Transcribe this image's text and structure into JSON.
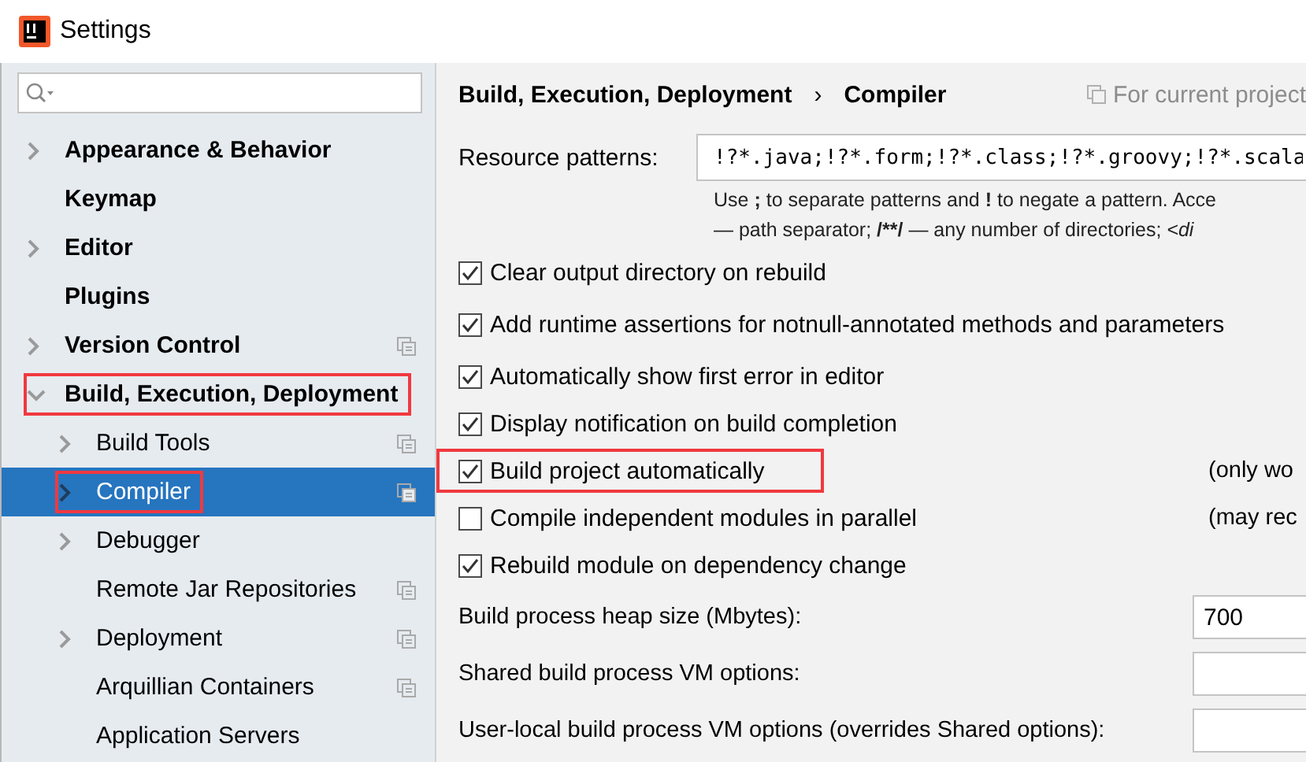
{
  "window": {
    "title": "Settings"
  },
  "tree": [
    {
      "label": "Appearance & Behavior",
      "expandable": true,
      "expanded": false,
      "project_level": false,
      "selected": false,
      "highlighted": false
    },
    {
      "label": "Keymap",
      "expandable": false,
      "project_level": false,
      "selected": false,
      "highlighted": false
    },
    {
      "label": "Editor",
      "expandable": true,
      "expanded": false,
      "project_level": false,
      "selected": false,
      "highlighted": false
    },
    {
      "label": "Plugins",
      "expandable": false,
      "project_level": false,
      "selected": false,
      "highlighted": false
    },
    {
      "label": "Version Control",
      "expandable": true,
      "expanded": false,
      "project_level": true,
      "selected": false,
      "highlighted": false
    },
    {
      "label": "Build, Execution, Deployment",
      "expandable": true,
      "expanded": true,
      "project_level": false,
      "selected": false,
      "highlighted": true,
      "children": [
        {
          "label": "Build Tools",
          "expandable": true,
          "expanded": false,
          "project_level": true,
          "selected": false,
          "highlighted": false
        },
        {
          "label": "Compiler",
          "expandable": true,
          "expanded": false,
          "project_level": true,
          "selected": true,
          "highlighted": true
        },
        {
          "label": "Debugger",
          "expandable": true,
          "expanded": false,
          "project_level": false,
          "selected": false,
          "highlighted": false
        },
        {
          "label": "Remote Jar Repositories",
          "expandable": false,
          "project_level": true,
          "selected": false,
          "highlighted": false
        },
        {
          "label": "Deployment",
          "expandable": true,
          "expanded": false,
          "project_level": true,
          "selected": false,
          "highlighted": false
        },
        {
          "label": "Arquillian Containers",
          "expandable": false,
          "project_level": true,
          "selected": false,
          "highlighted": false
        },
        {
          "label": "Application Servers",
          "expandable": false,
          "project_level": false,
          "selected": false,
          "highlighted": false
        }
      ]
    }
  ],
  "breadcrumb": {
    "parent": "Build, Execution, Deployment",
    "separator": "›",
    "current": "Compiler",
    "scope": "For current project"
  },
  "resource_patterns": {
    "label": "Resource patterns:",
    "value": "!?*.java;!?*.form;!?*.class;!?*.groovy;!?*.scala",
    "hint_lines": [
      [
        {
          "kind": "plain",
          "text": "Use "
        },
        {
          "kind": "bold",
          "text": ";"
        },
        {
          "kind": "plain",
          "text": " to separate patterns and "
        },
        {
          "kind": "bold",
          "text": "!"
        },
        {
          "kind": "plain",
          "text": " to negate a pattern. Acce"
        }
      ],
      [
        {
          "kind": "plain",
          "text": "— path separator; "
        },
        {
          "kind": "bold",
          "text": "/**/"
        },
        {
          "kind": "plain",
          "text": " — any number of directories; "
        },
        {
          "kind": "italic",
          "text": "<di"
        }
      ]
    ]
  },
  "options": [
    {
      "label": "Clear output directory on rebuild",
      "checked": true,
      "highlighted": false
    },
    {
      "label": "Add runtime assertions for notnull-annotated methods and parameters",
      "checked": true,
      "highlighted": false
    },
    {
      "label": "Automatically show first error in editor",
      "checked": true,
      "highlighted": false
    },
    {
      "label": "Display notification on build completion",
      "checked": true,
      "highlighted": false
    },
    {
      "label": "Build project automatically",
      "checked": true,
      "highlighted": true,
      "note": "(only wo"
    },
    {
      "label": "Compile independent modules in parallel",
      "checked": false,
      "highlighted": false,
      "note": "(may rec"
    },
    {
      "label": "Rebuild module on dependency change",
      "checked": true,
      "highlighted": false
    }
  ],
  "fields": [
    {
      "label": "Build process heap size (Mbytes):",
      "value": "700"
    },
    {
      "label": "Shared build process VM options:"
    },
    {
      "label": "User-local build process VM options (overrides Shared options):"
    }
  ]
}
